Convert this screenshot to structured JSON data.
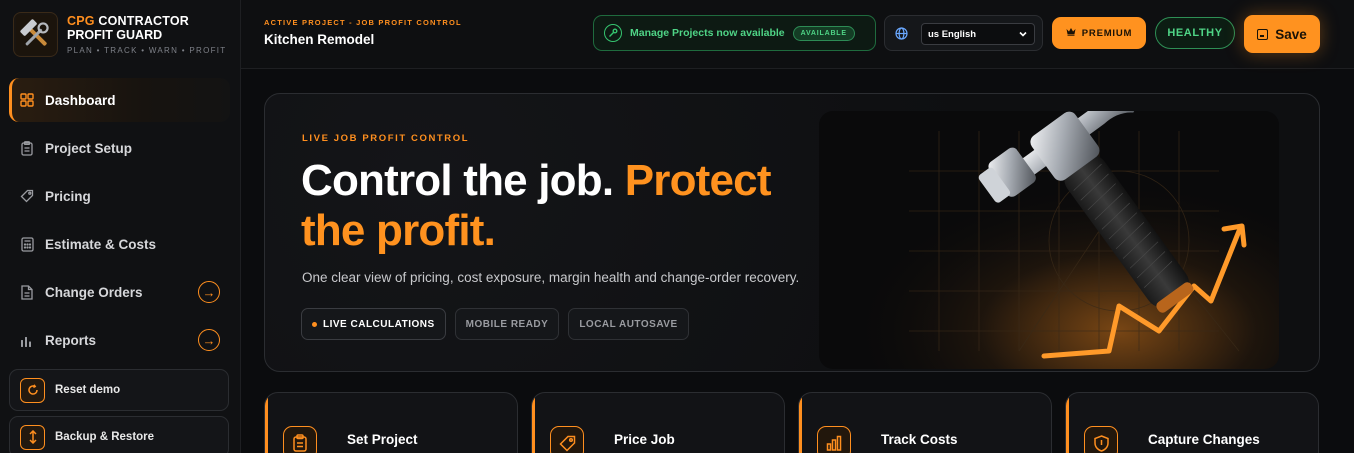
{
  "brand": {
    "name_accent": "CPG",
    "name_rest": "CONTRACTOR",
    "name_line2": "PROFIT GUARD",
    "tagline": "PLAN • TRACK • WARN • PROFIT",
    "logo_icon": "hammer-wrench-icon"
  },
  "sidebar": {
    "items": [
      {
        "label": "Dashboard",
        "icon": "grid-icon",
        "active": true
      },
      {
        "label": "Project Setup",
        "icon": "clipboard-icon",
        "active": false
      },
      {
        "label": "Pricing",
        "icon": "tag-icon",
        "active": false
      },
      {
        "label": "Estimate & Costs",
        "icon": "calculator-icon",
        "active": false
      },
      {
        "label": "Change Orders",
        "icon": "document-icon",
        "active": false,
        "arrow": "→"
      },
      {
        "label": "Reports",
        "icon": "bar-chart-icon",
        "active": false,
        "arrow": "→"
      }
    ],
    "reset_label": "Reset demo",
    "backup_label": "Backup & Restore"
  },
  "header": {
    "eyebrow": "ACTIVE PROJECT - JOB PROFIT CONTROL",
    "project_name": "Kitchen Remodel",
    "notice_text": "Manage Projects now available",
    "notice_badge": "AVAILABLE",
    "language_value": "us English",
    "premium_label": "PREMIUM",
    "status_label": "HEALTHY",
    "save_label": "Save"
  },
  "hero": {
    "eyebrow": "LIVE JOB PROFIT CONTROL",
    "title_part1": "Control the job.",
    "title_part2": "Protect the profit.",
    "subtitle": "One clear view of pricing, cost exposure, margin health and change-order recovery.",
    "chips": [
      "LIVE CALCULATIONS",
      "MOBILE READY",
      "LOCAL AUTOSAVE"
    ]
  },
  "cards": [
    {
      "title": "Set Project",
      "icon": "clipboard-icon"
    },
    {
      "title": "Price Job",
      "icon": "tag-icon"
    },
    {
      "title": "Track Costs",
      "icon": "bar-chart-icon"
    },
    {
      "title": "Capture Changes",
      "icon": "shield-icon"
    }
  ],
  "colors": {
    "accent": "#ff921f",
    "success": "#4fd486",
    "background": "#0b0c0e"
  }
}
